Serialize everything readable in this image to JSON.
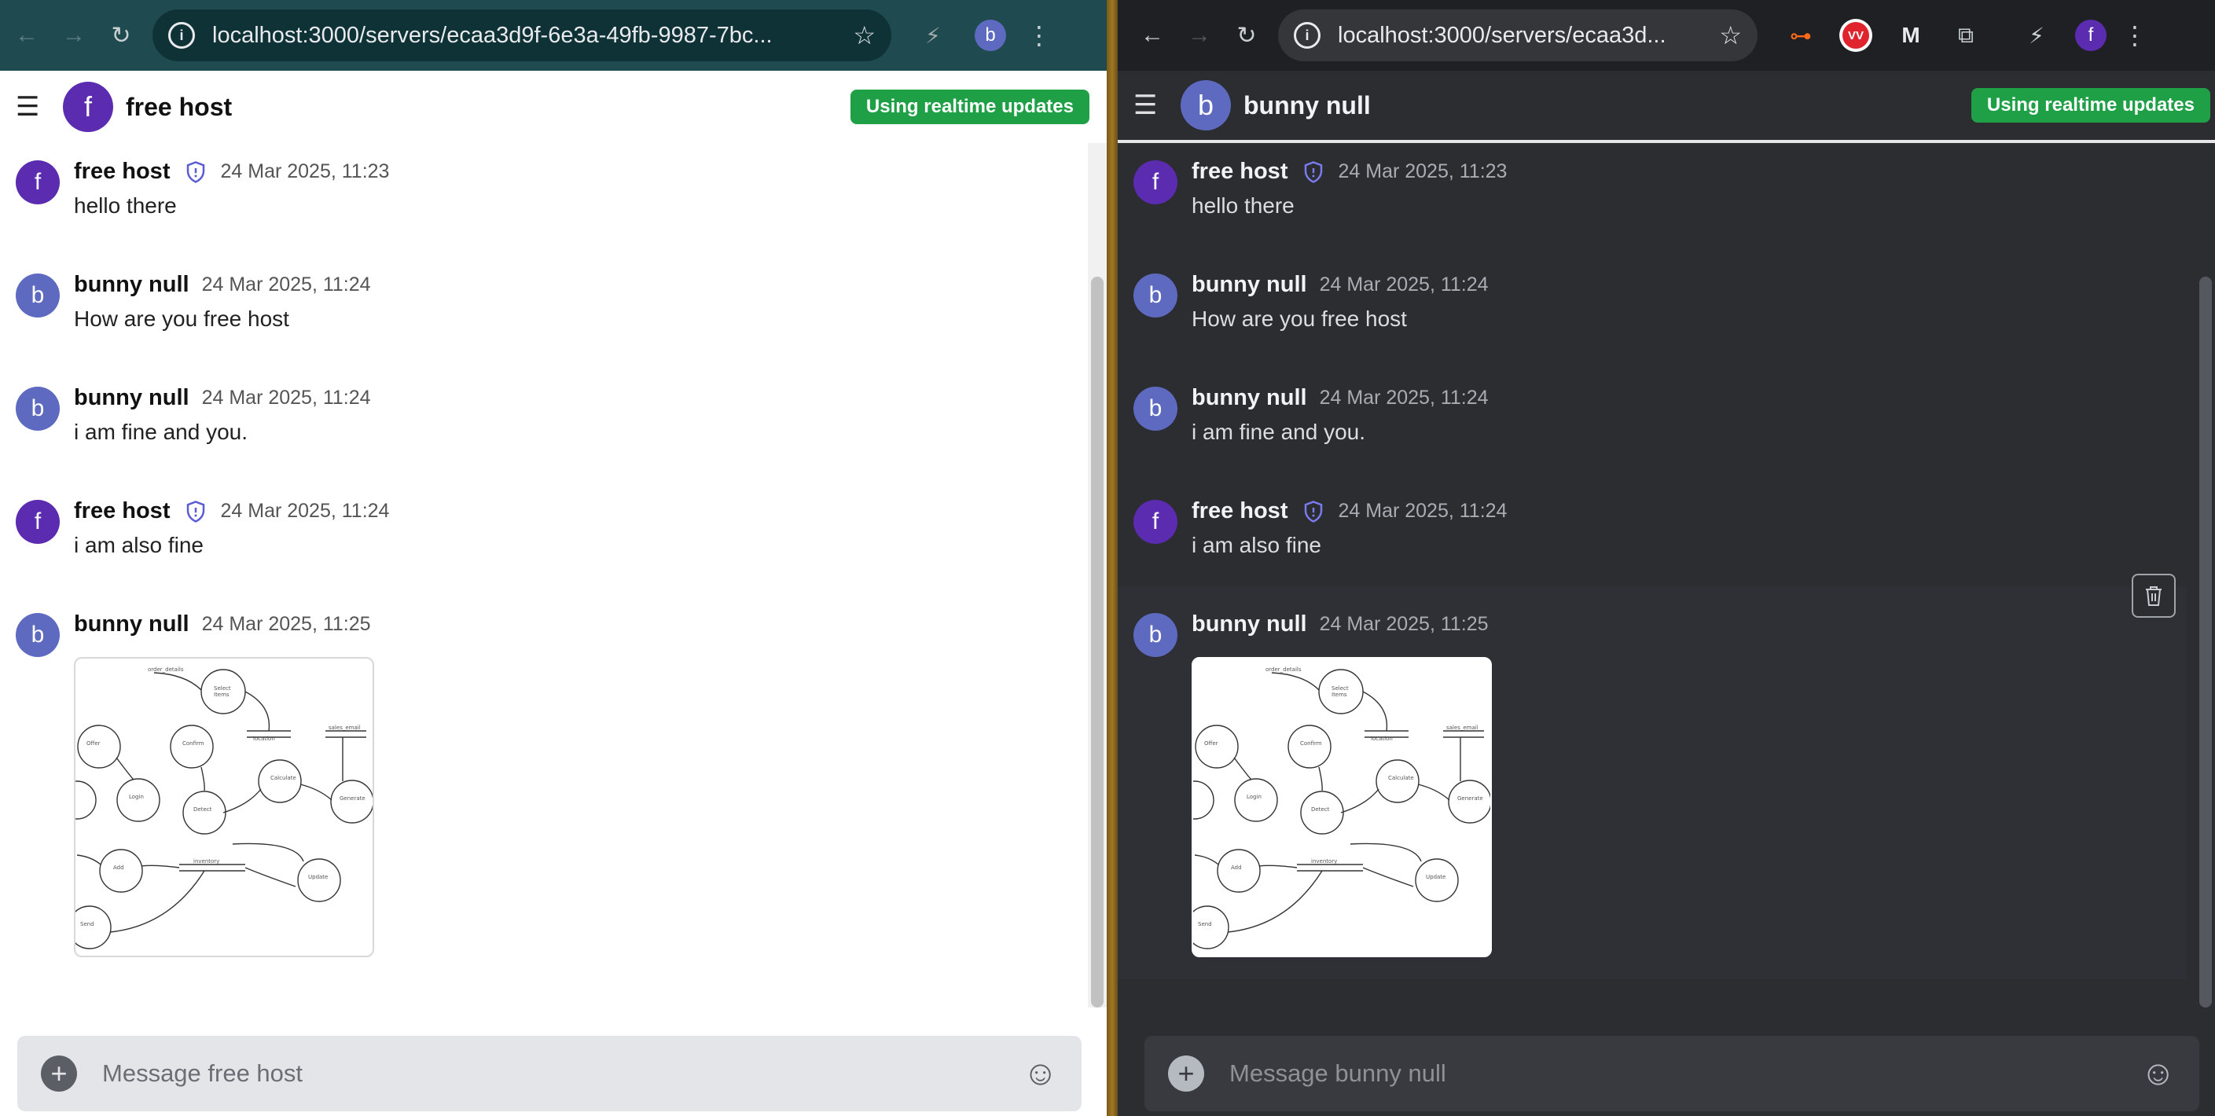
{
  "left": {
    "url": "localhost:3000/servers/ecaa3d9f-6e3a-49fb-9987-7bc...",
    "profile_initial": "b",
    "header_avatar": "f",
    "header_title": "free host",
    "realtime_label": "Using realtime updates",
    "composer_placeholder": "Message free host",
    "colors": {
      "chrome": "#1f4a4f",
      "badge": "#1fa046"
    }
  },
  "right": {
    "url": "localhost:3000/servers/ecaa3d...",
    "profile_initial": "f",
    "header_avatar": "b",
    "header_title": "bunny null",
    "realtime_label": "Using realtime updates",
    "composer_placeholder": "Message bunny null",
    "colors": {
      "chrome": "#1f2023",
      "background": "#2b2d31"
    },
    "extensions": [
      "link-icon",
      "vv-icon",
      "malwarebytes-icon",
      "puzzle-icon",
      "performance-icon"
    ]
  },
  "messages": [
    {
      "initial": "f",
      "author": "free host",
      "owner_badge": true,
      "time": "24 Mar 2025, 11:23",
      "text": "hello there"
    },
    {
      "initial": "b",
      "author": "bunny null",
      "owner_badge": false,
      "time": "24 Mar 2025, 11:24",
      "text": "How are you free host"
    },
    {
      "initial": "b",
      "author": "bunny null",
      "owner_badge": false,
      "time": "24 Mar 2025, 11:24",
      "text": "i am fine and you."
    },
    {
      "initial": "f",
      "author": "free host",
      "owner_badge": true,
      "time": "24 Mar 2025, 11:24",
      "text": "i am also fine"
    },
    {
      "initial": "b",
      "author": "bunny null",
      "owner_badge": false,
      "time": "24 Mar 2025, 11:25",
      "text": "",
      "attachment": "data-flow-diagram-image"
    }
  ]
}
